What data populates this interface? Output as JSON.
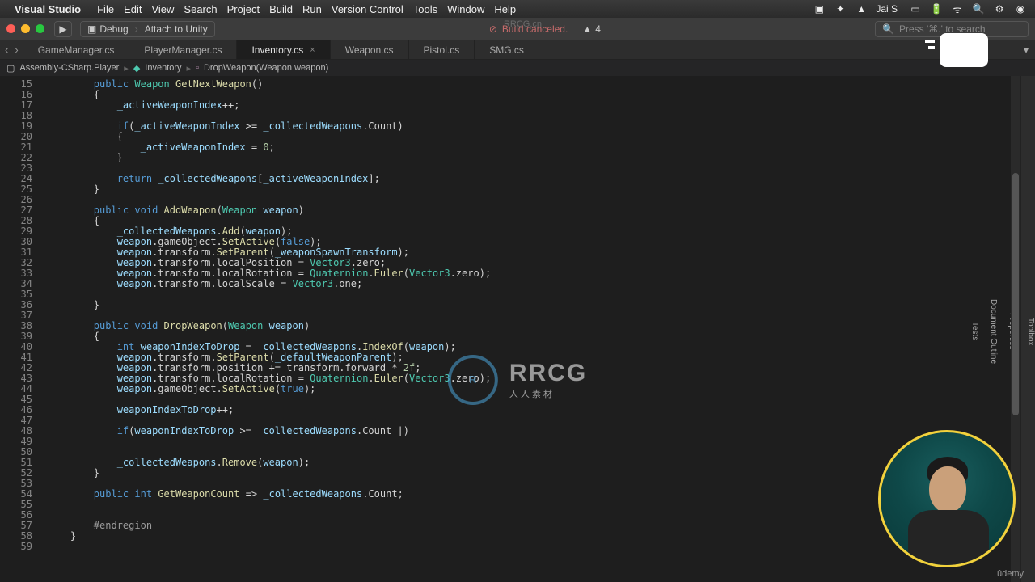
{
  "menubar": {
    "app": "Visual Studio",
    "items": [
      "File",
      "Edit",
      "View",
      "Search",
      "Project",
      "Build",
      "Run",
      "Version Control",
      "Tools",
      "Window",
      "Help"
    ],
    "user": "Jai S"
  },
  "toolbar": {
    "config": "Debug",
    "target": "Attach to Unity",
    "build_status": "Build canceled.",
    "warnings": "4",
    "search_placeholder": "Press '⌘.' to search"
  },
  "tabs": [
    {
      "label": "GameManager.cs",
      "active": false
    },
    {
      "label": "PlayerManager.cs",
      "active": false
    },
    {
      "label": "Inventory.cs",
      "active": true
    },
    {
      "label": "Weapon.cs",
      "active": false
    },
    {
      "label": "Pistol.cs",
      "active": false
    },
    {
      "label": "SMG.cs",
      "active": false
    }
  ],
  "breadcrumb": {
    "project": "Assembly-CSharp.Player",
    "class": "Inventory",
    "member": "DropWeapon(Weapon weapon)"
  },
  "side_panels": [
    "Toolbox",
    "Properties",
    "Document Outline",
    "Tests"
  ],
  "code": {
    "first_line": 15,
    "lines": [
      {
        "n": 15,
        "indent": 2,
        "tokens": [
          [
            "kw",
            "public"
          ],
          [
            " "
          ],
          [
            "type",
            "Weapon"
          ],
          [
            " "
          ],
          [
            "fn",
            "GetNextWeapon"
          ],
          [
            "",
            "()"
          ]
        ]
      },
      {
        "n": 16,
        "indent": 2,
        "tokens": [
          [
            "",
            "{"
          ]
        ]
      },
      {
        "n": 17,
        "indent": 3,
        "tokens": [
          [
            "var",
            "_activeWeaponIndex"
          ],
          [
            "",
            "++;"
          ]
        ]
      },
      {
        "n": 18,
        "indent": 0,
        "tokens": []
      },
      {
        "n": 19,
        "indent": 3,
        "tokens": [
          [
            "kw",
            "if"
          ],
          [
            "",
            "("
          ],
          [
            "var",
            "_activeWeaponIndex"
          ],
          [
            "",
            " >= "
          ],
          [
            "var",
            "_collectedWeapons"
          ],
          [
            ".",
            ""
          ],
          [
            "prop",
            "Count"
          ],
          [
            "",
            ")"
          ]
        ]
      },
      {
        "n": 20,
        "indent": 3,
        "tokens": [
          [
            "",
            "{"
          ]
        ]
      },
      {
        "n": 21,
        "indent": 4,
        "tokens": [
          [
            "var",
            "_activeWeaponIndex"
          ],
          [
            "",
            " = "
          ],
          [
            "num",
            "0"
          ],
          [
            "",
            ";"
          ]
        ]
      },
      {
        "n": 22,
        "indent": 3,
        "tokens": [
          [
            "",
            "}"
          ]
        ]
      },
      {
        "n": 23,
        "indent": 0,
        "tokens": []
      },
      {
        "n": 24,
        "indent": 3,
        "tokens": [
          [
            "kw",
            "return"
          ],
          [
            " "
          ],
          [
            "var",
            "_collectedWeapons"
          ],
          [
            "",
            "["
          ],
          [
            "var",
            "_activeWeaponIndex"
          ],
          [
            "",
            "];"
          ]
        ]
      },
      {
        "n": 25,
        "indent": 2,
        "tokens": [
          [
            "",
            "}"
          ]
        ]
      },
      {
        "n": 26,
        "indent": 0,
        "tokens": []
      },
      {
        "n": 27,
        "indent": 2,
        "tokens": [
          [
            "kw",
            "public"
          ],
          [
            " "
          ],
          [
            "kw",
            "void"
          ],
          [
            " "
          ],
          [
            "fn",
            "AddWeapon"
          ],
          [
            "",
            "("
          ],
          [
            "type",
            "Weapon"
          ],
          [
            " "
          ],
          [
            "var",
            "weapon"
          ],
          [
            "",
            ")"
          ]
        ]
      },
      {
        "n": 28,
        "indent": 2,
        "tokens": [
          [
            "",
            "{"
          ]
        ]
      },
      {
        "n": 29,
        "indent": 3,
        "tokens": [
          [
            "var",
            "_collectedWeapons"
          ],
          [
            ".",
            ""
          ],
          [
            "fn",
            "Add"
          ],
          [
            "",
            "("
          ],
          [
            "var",
            "weapon"
          ],
          [
            "",
            ");"
          ]
        ]
      },
      {
        "n": 30,
        "indent": 3,
        "tokens": [
          [
            "var",
            "weapon"
          ],
          [
            ".",
            ""
          ],
          [
            "prop",
            "gameObject"
          ],
          [
            ".",
            ""
          ],
          [
            "fn",
            "SetActive"
          ],
          [
            "",
            "("
          ],
          [
            "boolv",
            "false"
          ],
          [
            "",
            ");"
          ]
        ]
      },
      {
        "n": 31,
        "indent": 3,
        "tokens": [
          [
            "var",
            "weapon"
          ],
          [
            ".",
            ""
          ],
          [
            "prop",
            "transform"
          ],
          [
            ".",
            ""
          ],
          [
            "fn",
            "SetParent"
          ],
          [
            "",
            "("
          ],
          [
            "var",
            "_weaponSpawnTransform"
          ],
          [
            "",
            ");"
          ]
        ]
      },
      {
        "n": 32,
        "indent": 3,
        "tokens": [
          [
            "var",
            "weapon"
          ],
          [
            ".",
            ""
          ],
          [
            "prop",
            "transform"
          ],
          [
            ".",
            ""
          ],
          [
            "prop",
            "localPosition"
          ],
          [
            "",
            " = "
          ],
          [
            "type",
            "Vector3"
          ],
          [
            ".",
            ""
          ],
          [
            "prop",
            "zero"
          ],
          [
            "",
            ";"
          ]
        ]
      },
      {
        "n": 33,
        "indent": 3,
        "tokens": [
          [
            "var",
            "weapon"
          ],
          [
            ".",
            ""
          ],
          [
            "prop",
            "transform"
          ],
          [
            ".",
            ""
          ],
          [
            "prop",
            "localRotation"
          ],
          [
            "",
            " = "
          ],
          [
            "type",
            "Quaternion"
          ],
          [
            ".",
            ""
          ],
          [
            "fn",
            "Euler"
          ],
          [
            "",
            "("
          ],
          [
            "type",
            "Vector3"
          ],
          [
            ".",
            ""
          ],
          [
            "prop",
            "zero"
          ],
          [
            "",
            ");"
          ]
        ]
      },
      {
        "n": 34,
        "indent": 3,
        "tokens": [
          [
            "var",
            "weapon"
          ],
          [
            ".",
            ""
          ],
          [
            "prop",
            "transform"
          ],
          [
            ".",
            ""
          ],
          [
            "prop",
            "localScale"
          ],
          [
            "",
            " = "
          ],
          [
            "type",
            "Vector3"
          ],
          [
            ".",
            ""
          ],
          [
            "prop",
            "one"
          ],
          [
            "",
            ";"
          ]
        ]
      },
      {
        "n": 35,
        "indent": 0,
        "tokens": []
      },
      {
        "n": 36,
        "indent": 2,
        "tokens": [
          [
            "",
            "}"
          ]
        ]
      },
      {
        "n": 37,
        "indent": 0,
        "tokens": []
      },
      {
        "n": 38,
        "indent": 2,
        "tokens": [
          [
            "kw",
            "public"
          ],
          [
            " "
          ],
          [
            "kw",
            "void"
          ],
          [
            " "
          ],
          [
            "fn",
            "DropWeapon"
          ],
          [
            "",
            "("
          ],
          [
            "type",
            "Weapon"
          ],
          [
            " "
          ],
          [
            "var",
            "weapon"
          ],
          [
            "",
            ")"
          ]
        ]
      },
      {
        "n": 39,
        "indent": 2,
        "tokens": [
          [
            "",
            "{"
          ]
        ]
      },
      {
        "n": 40,
        "indent": 3,
        "tokens": [
          [
            "kw",
            "int"
          ],
          [
            " "
          ],
          [
            "var",
            "weaponIndexToDrop"
          ],
          [
            "",
            " = "
          ],
          [
            "var",
            "_collectedWeapons"
          ],
          [
            ".",
            ""
          ],
          [
            "fn",
            "IndexOf"
          ],
          [
            "",
            "("
          ],
          [
            "var",
            "weapon"
          ],
          [
            "",
            ");"
          ]
        ]
      },
      {
        "n": 41,
        "indent": 3,
        "tokens": [
          [
            "var",
            "weapon"
          ],
          [
            ".",
            ""
          ],
          [
            "prop",
            "transform"
          ],
          [
            ".",
            ""
          ],
          [
            "fn",
            "SetParent"
          ],
          [
            "",
            "("
          ],
          [
            "var",
            "_defaultWeaponParent"
          ],
          [
            "",
            ");"
          ]
        ]
      },
      {
        "n": 42,
        "indent": 3,
        "tokens": [
          [
            "var",
            "weapon"
          ],
          [
            ".",
            ""
          ],
          [
            "prop",
            "transform"
          ],
          [
            ".",
            ""
          ],
          [
            "prop",
            "position"
          ],
          [
            "",
            " += "
          ],
          [
            "prop",
            "transform"
          ],
          [
            ".",
            ""
          ],
          [
            "prop",
            "forward"
          ],
          [
            "",
            " * "
          ],
          [
            "num",
            "2f"
          ],
          [
            "",
            ";"
          ]
        ]
      },
      {
        "n": 43,
        "indent": 3,
        "tokens": [
          [
            "var",
            "weapon"
          ],
          [
            ".",
            ""
          ],
          [
            "prop",
            "transform"
          ],
          [
            ".",
            ""
          ],
          [
            "prop",
            "localRotation"
          ],
          [
            "",
            " = "
          ],
          [
            "type",
            "Quaternion"
          ],
          [
            ".",
            ""
          ],
          [
            "fn",
            "Euler"
          ],
          [
            "",
            "("
          ],
          [
            "type",
            "Vector3"
          ],
          [
            ".",
            ""
          ],
          [
            "prop",
            "zero"
          ],
          [
            "",
            ");"
          ]
        ]
      },
      {
        "n": 44,
        "indent": 3,
        "tokens": [
          [
            "var",
            "weapon"
          ],
          [
            ".",
            ""
          ],
          [
            "prop",
            "gameObject"
          ],
          [
            ".",
            ""
          ],
          [
            "fn",
            "SetActive"
          ],
          [
            "",
            "("
          ],
          [
            "boolv",
            "true"
          ],
          [
            "",
            ");"
          ]
        ]
      },
      {
        "n": 45,
        "indent": 0,
        "tokens": []
      },
      {
        "n": 46,
        "indent": 3,
        "tokens": [
          [
            "var",
            "weaponIndexToDrop"
          ],
          [
            "",
            "++;"
          ]
        ]
      },
      {
        "n": 47,
        "indent": 0,
        "tokens": []
      },
      {
        "n": 48,
        "indent": 3,
        "tokens": [
          [
            "kw",
            "if"
          ],
          [
            "",
            "("
          ],
          [
            "var",
            "weaponIndexToDrop"
          ],
          [
            "",
            " >= "
          ],
          [
            "var",
            "_collectedWeapons"
          ],
          [
            ".",
            ""
          ],
          [
            "prop",
            "Count"
          ],
          [
            "",
            " "
          ],
          [
            "",
            "|)"
          ]
        ]
      },
      {
        "n": 49,
        "indent": 0,
        "tokens": []
      },
      {
        "n": 50,
        "indent": 0,
        "tokens": []
      },
      {
        "n": 51,
        "indent": 3,
        "tokens": [
          [
            "var",
            "_collectedWeapons"
          ],
          [
            ".",
            ""
          ],
          [
            "fn",
            "Remove"
          ],
          [
            "",
            "("
          ],
          [
            "var",
            "weapon"
          ],
          [
            "",
            ");"
          ]
        ]
      },
      {
        "n": 52,
        "indent": 2,
        "tokens": [
          [
            "",
            "}"
          ]
        ]
      },
      {
        "n": 53,
        "indent": 0,
        "tokens": []
      },
      {
        "n": 54,
        "indent": 2,
        "tokens": [
          [
            "kw",
            "public"
          ],
          [
            " "
          ],
          [
            "kw",
            "int"
          ],
          [
            " "
          ],
          [
            "fn",
            "GetWeaponCount"
          ],
          [
            "",
            " => "
          ],
          [
            "var",
            "_collectedWeapons"
          ],
          [
            ".",
            ""
          ],
          [
            "prop",
            "Count"
          ],
          [
            "",
            ";"
          ]
        ]
      },
      {
        "n": 55,
        "indent": 0,
        "tokens": []
      },
      {
        "n": 56,
        "indent": 0,
        "tokens": []
      },
      {
        "n": 57,
        "indent": 2,
        "tokens": [
          [
            "region",
            "#endregion"
          ]
        ]
      },
      {
        "n": 58,
        "indent": 1,
        "tokens": [
          [
            "",
            "}"
          ]
        ]
      },
      {
        "n": 59,
        "indent": 0,
        "tokens": []
      }
    ]
  },
  "watermark": {
    "top": "RRCG.cn",
    "big": "RRCG",
    "sub": "人人素材"
  },
  "footer": {
    "brand": "ûdemy"
  }
}
